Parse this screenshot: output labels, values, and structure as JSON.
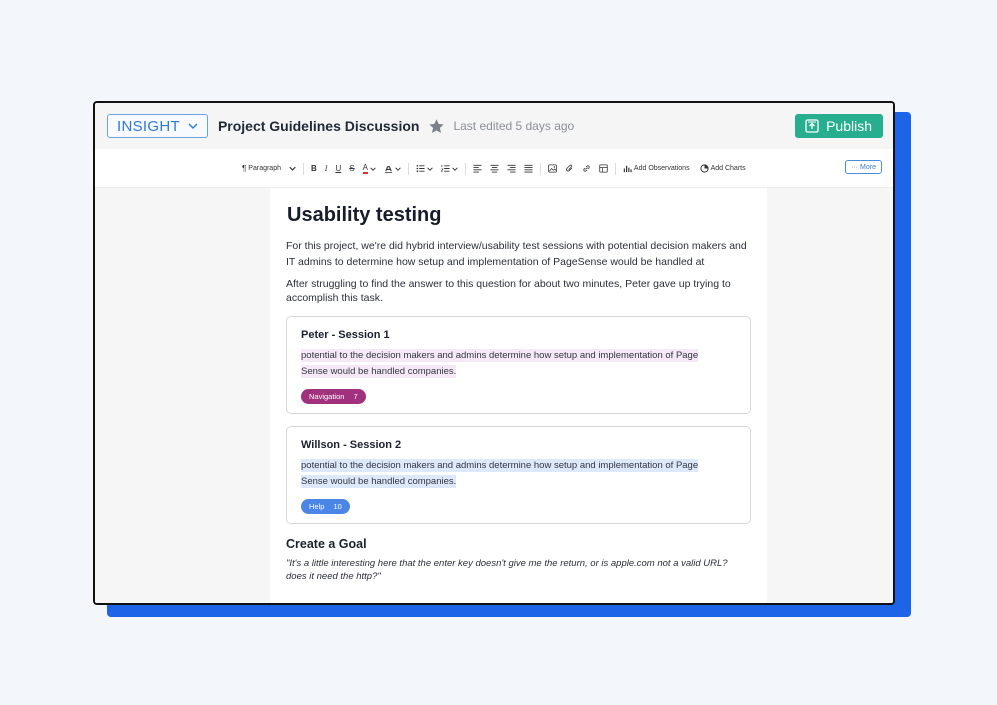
{
  "header": {
    "insight_label": "INSIGHT",
    "doc_title": "Project Guidelines Discussion",
    "last_edited": "Last edited 5 days ago",
    "publish_label": "Publish"
  },
  "toolbar": {
    "paragraph_label": "Paragraph",
    "bold": "B",
    "italic": "I",
    "underline": "U",
    "strike": "S",
    "font_color": "A",
    "add_observations": "Add Observations",
    "add_charts": "Add Charts",
    "more_label": "More"
  },
  "content": {
    "heading": "Usability testing",
    "para1": "For this project, we're did hybrid interview/usability test sessions with potential decision makers and IT admins to determine how setup and implementation of PageSense would be handled at",
    "para2": "After struggling to find the answer to this question for about two minutes, Peter gave up trying to accomplish this task.",
    "sessions": [
      {
        "title": "Peter - Session 1",
        "highlight": "potential to the decision makers and admins determine how setup and implementation of Page Sense would be handled companies.",
        "tag_label": "Navigation",
        "tag_count": "7"
      },
      {
        "title": "Willson - Session 2",
        "highlight": "potential to the decision makers and admins determine how setup and implementation of Page Sense would be handled companies.",
        "tag_label": "Help",
        "tag_count": "10"
      }
    ],
    "goal_heading": "Create a Goal",
    "goal_quote": "\"It's a little interesting here that the enter key doesn't give me the return, or is apple.com not a valid URL? does it need the http?\""
  },
  "colors": {
    "accent_blue": "#1d64e8",
    "publish_green": "#27ae8f",
    "tag_purple": "#a1317c",
    "tag_blue": "#4b86e6"
  }
}
